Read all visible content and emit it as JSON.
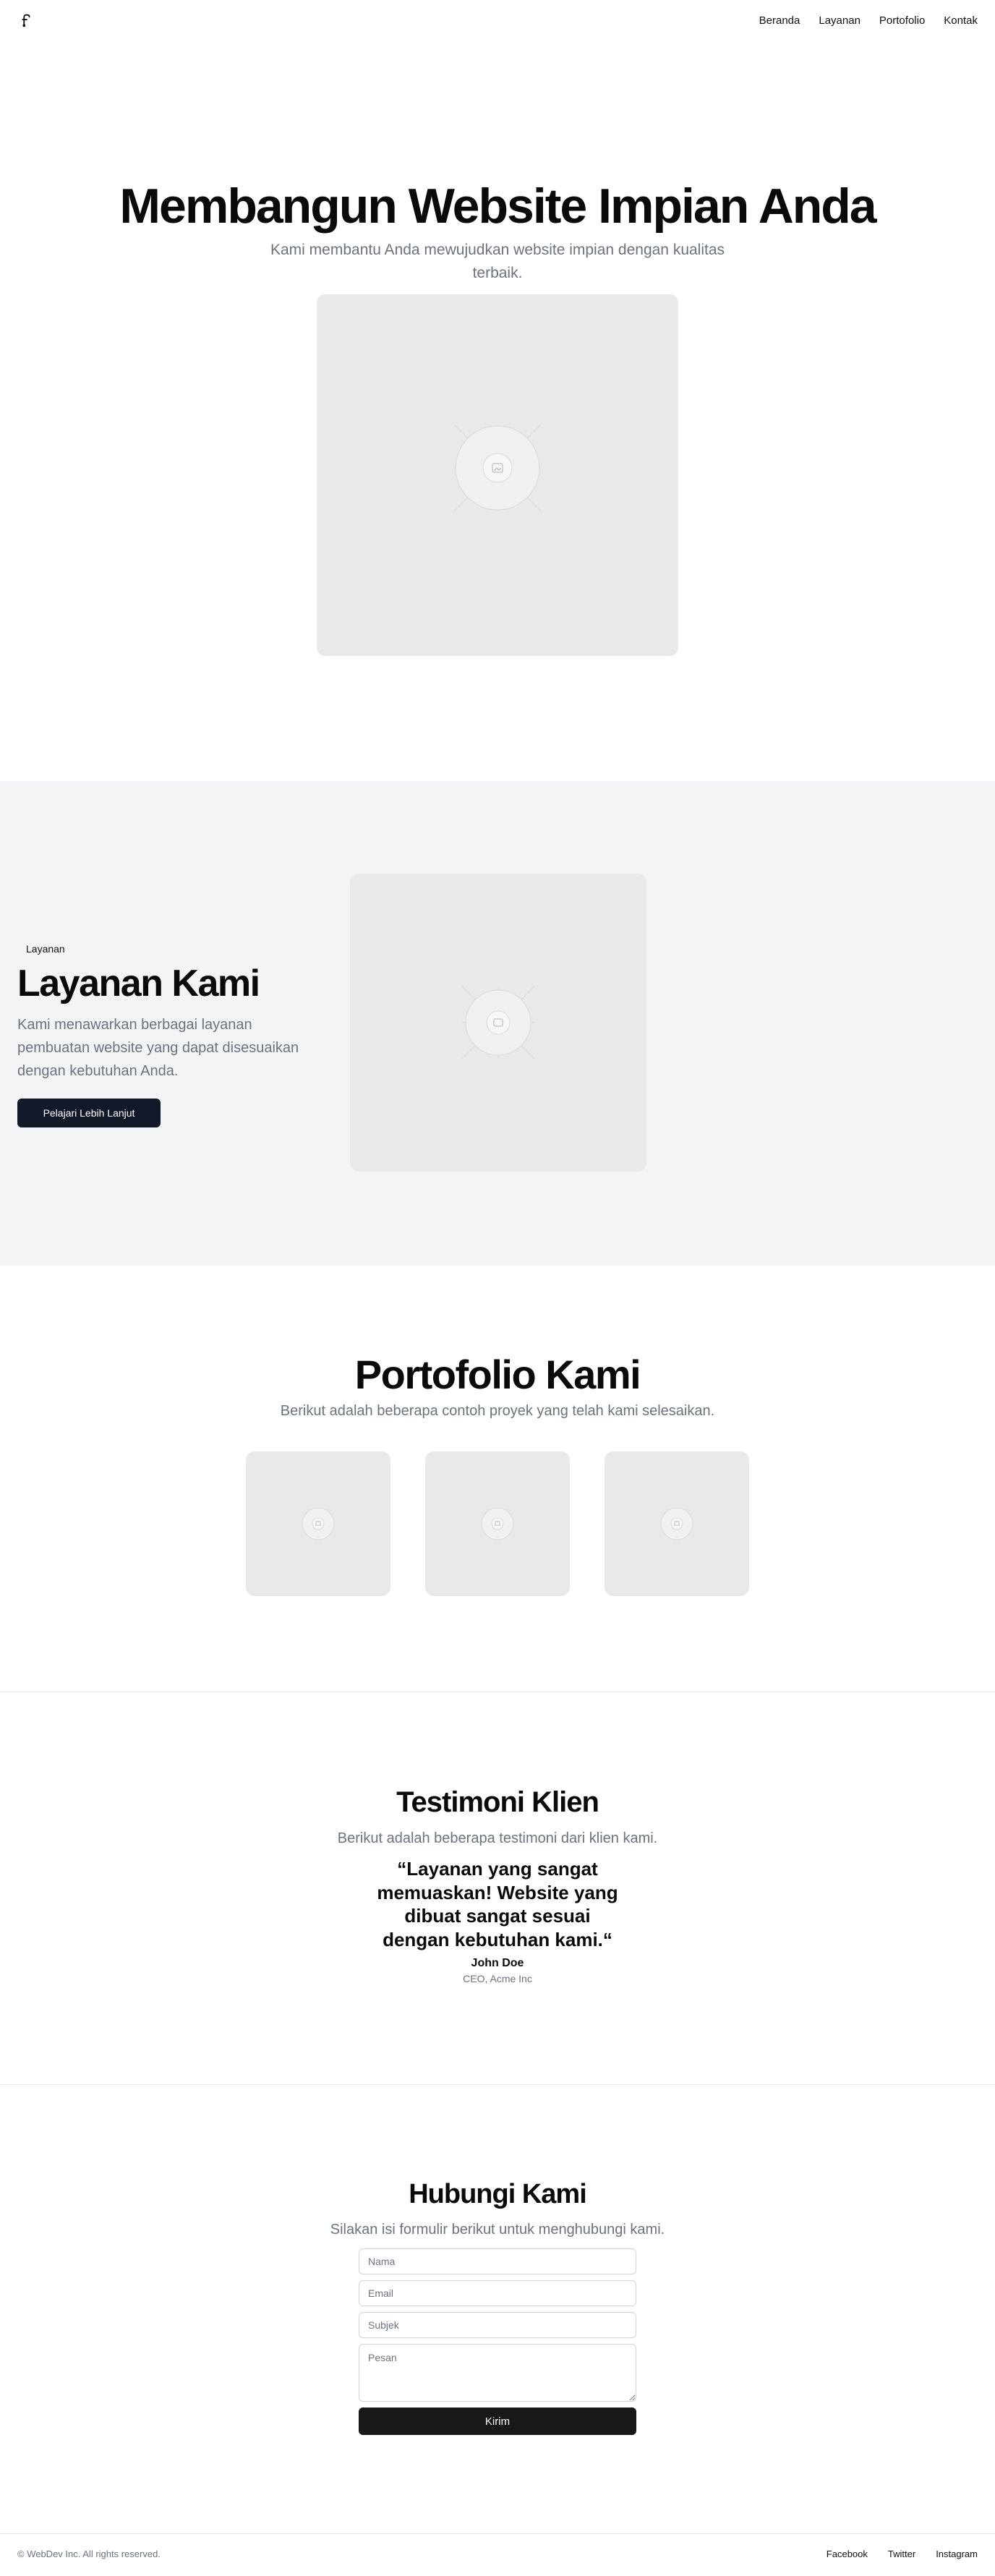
{
  "header": {
    "logo_icon": "pen-nib-icon",
    "nav": [
      "Beranda",
      "Layanan",
      "Portofolio",
      "Kontak"
    ]
  },
  "hero": {
    "title": "Membangun Website Impian Anda",
    "subtitle": "Kami membantu Anda mewujudkan website impian dengan kualitas terbaik."
  },
  "services": {
    "badge": "Layanan",
    "title": "Layanan Kami",
    "description": "Kami menawarkan berbagai layanan pembuatan website yang dapat disesuaikan dengan kebutuhan Anda.",
    "button": "Pelajari Lebih Lanjut"
  },
  "portfolio": {
    "title": "Portofolio Kami",
    "subtitle": "Berikut adalah beberapa contoh proyek yang telah kami selesaikan."
  },
  "testimonials": {
    "title": "Testimoni Klien",
    "subtitle": "Berikut adalah beberapa testimoni dari klien kami.",
    "quote": "“Layanan yang sangat memuaskan! Website yang dibuat sangat sesuai dengan kebutuhan kami.“",
    "author": "John Doe",
    "role": "CEO, Acme Inc"
  },
  "contact": {
    "title": "Hubungi Kami",
    "subtitle": "Silakan isi formulir berikut untuk menghubungi kami.",
    "name_placeholder": "Nama",
    "email_placeholder": "Email",
    "subject_placeholder": "Subjek",
    "message_placeholder": "Pesan",
    "submit": "Kirim"
  },
  "footer": {
    "copyright": "© WebDev Inc. All rights reserved.",
    "links": [
      "Facebook",
      "Twitter",
      "Instagram"
    ]
  },
  "colors": {
    "primary_dark": "#111827",
    "muted_text": "#6b7280",
    "section_bg": "#f3f4f6",
    "placeholder_bg": "#e9e9e9"
  }
}
